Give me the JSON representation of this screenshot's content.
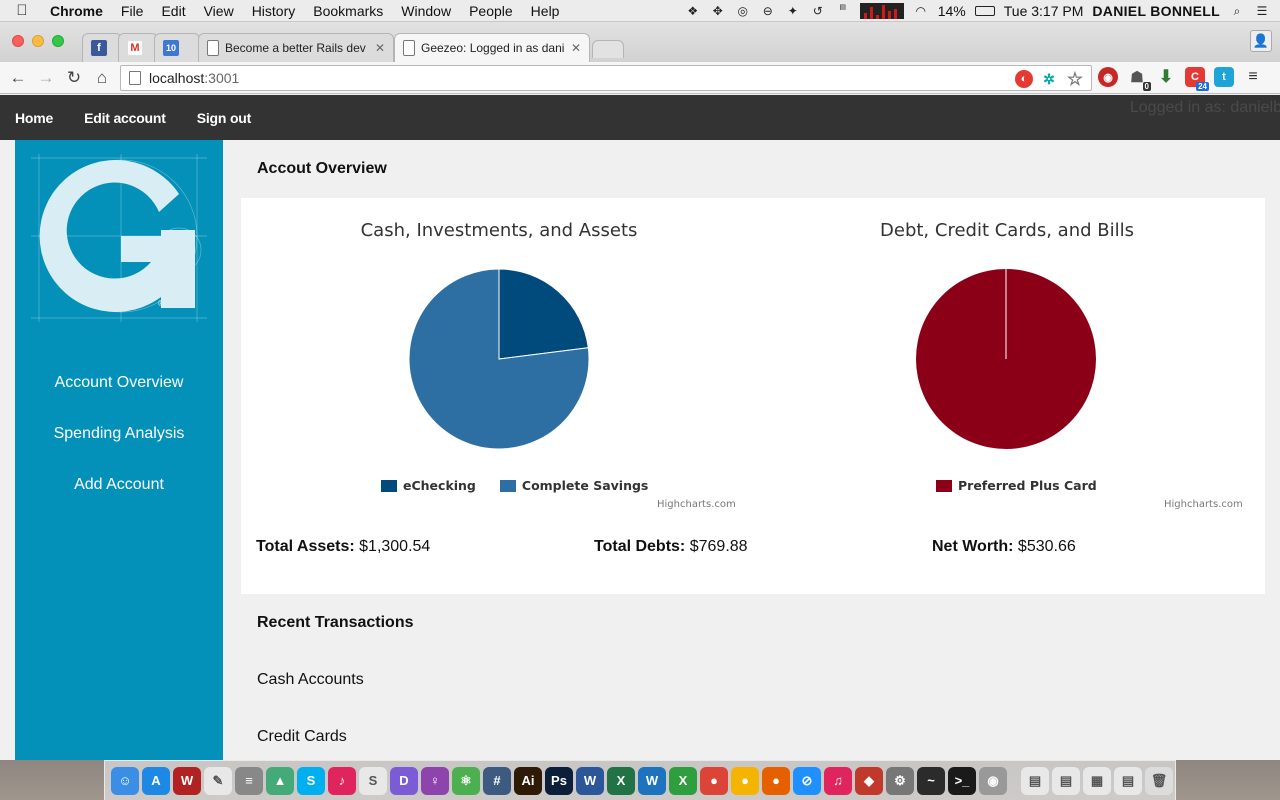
{
  "menubar": {
    "app": "Chrome",
    "items": [
      "File",
      "Edit",
      "View",
      "History",
      "Bookmarks",
      "Window",
      "People",
      "Help"
    ],
    "battery": "14%",
    "clock": "Tue 3:17 PM",
    "user": "DANIEL BONNELL"
  },
  "tabs": [
    {
      "title": "",
      "icon": "facebook-icon",
      "color": "#3b5998",
      "glyph": "f"
    },
    {
      "title": "",
      "icon": "gmail-icon",
      "color": "#ffffff",
      "glyph": "M"
    },
    {
      "title": "",
      "icon": "calendar-icon",
      "color": "#3f78d3",
      "glyph": "10"
    },
    {
      "title": "Become a better Rails dev",
      "icon": "page-icon"
    },
    {
      "title": "Geezeo: Logged in as dani",
      "icon": "page-icon",
      "active": true
    }
  ],
  "toolbar": {
    "url_host": "localhost",
    "url_port": ":3001",
    "calendar_badge": "10",
    "ext_badge_1": "0",
    "ext_badge_2": "24"
  },
  "sitenav": {
    "home": "Home",
    "edit_account": "Edit account",
    "sign_out": "Sign out",
    "logged_in": "Logged in as: danielb"
  },
  "sidebar": {
    "items": [
      "Account Overview",
      "Spending Analysis",
      "Add Account"
    ]
  },
  "main": {
    "overview_title": "Accout Overview",
    "recent_title": "Recent Transactions",
    "cash_accounts": "Cash Accounts",
    "credit_cards": "Credit Cards",
    "totals": {
      "assets_label": "Total Assets:",
      "assets_value": "$1,300.54",
      "debts_label": "Total Debts:",
      "debts_value": "$769.88",
      "net_label": "Net Worth:",
      "net_value": "$530.66"
    },
    "credits": "Highcharts.com"
  },
  "colors": {
    "nav_bg": "#333333",
    "sidebar_bg": "#0391ba",
    "echecking": "#004a7c",
    "savings": "#2e6fa3",
    "credit_card": "#8b0017"
  },
  "chart_data": [
    {
      "type": "pie",
      "title": "Cash, Investments, and Assets",
      "series": [
        {
          "name": "eChecking",
          "value": 23
        },
        {
          "name": "Complete Savings",
          "value": 77
        }
      ]
    },
    {
      "type": "pie",
      "title": "Debt, Credit Cards, and Bills",
      "series": [
        {
          "name": "Preferred Plus Card",
          "value": 100
        }
      ]
    }
  ],
  "dock": {
    "apps": [
      {
        "name": "finder-icon",
        "color": "#3a8ee6",
        "glyph": "☺"
      },
      {
        "name": "app-store-icon",
        "color": "#1e88e5",
        "glyph": "A"
      },
      {
        "name": "wineskin-icon",
        "color": "#b22222",
        "glyph": "W"
      },
      {
        "name": "textedit-icon",
        "color": "#e8e8e8",
        "glyph": "✎"
      },
      {
        "name": "notes-icon",
        "color": "#888888",
        "glyph": "≡"
      },
      {
        "name": "image-icon",
        "color": "#4a7",
        "glyph": "▲"
      },
      {
        "name": "skype-icon",
        "color": "#00aff0",
        "glyph": "S"
      },
      {
        "name": "music-app-icon",
        "color": "#e0245e",
        "glyph": "♪"
      },
      {
        "name": "slack-icon",
        "color": "#e8e8e8",
        "glyph": "S"
      },
      {
        "name": "dash-icon",
        "color": "#7b5bd6",
        "glyph": "D"
      },
      {
        "name": "tower-icon",
        "color": "#8e44ad",
        "glyph": "♀"
      },
      {
        "name": "atom-icon",
        "color": "#4caf50",
        "glyph": "⚛"
      },
      {
        "name": "calculator-icon",
        "color": "#3d5a80",
        "glyph": "#"
      },
      {
        "name": "illustrator-icon",
        "color": "#2f1a06",
        "glyph": "Ai"
      },
      {
        "name": "photoshop-icon",
        "color": "#0b1f3a",
        "glyph": "Ps"
      },
      {
        "name": "word-icon",
        "color": "#2b579a",
        "glyph": "W"
      },
      {
        "name": "excel-icon",
        "color": "#217346",
        "glyph": "X"
      },
      {
        "name": "word-alt-icon",
        "color": "#1e73be",
        "glyph": "W"
      },
      {
        "name": "crossover-icon",
        "color": "#2e9e3e",
        "glyph": "X"
      },
      {
        "name": "chrome-icon",
        "color": "#db4437",
        "glyph": "●"
      },
      {
        "name": "chrome-canary-icon",
        "color": "#f4b400",
        "glyph": "●"
      },
      {
        "name": "firefox-icon",
        "color": "#e66000",
        "glyph": "●"
      },
      {
        "name": "safari-icon",
        "color": "#1e90ff",
        "glyph": "⊘"
      },
      {
        "name": "itunes-icon",
        "color": "#e0245e",
        "glyph": "♫"
      },
      {
        "name": "codekit-icon",
        "color": "#c0392b",
        "glyph": "◆"
      },
      {
        "name": "system-preferences-icon",
        "color": "#777777",
        "glyph": "⚙"
      },
      {
        "name": "activity-monitor-icon",
        "color": "#2b2b2b",
        "glyph": "~"
      },
      {
        "name": "terminal-icon",
        "color": "#1a1a1a",
        "glyph": ">_"
      },
      {
        "name": "preview-icon",
        "color": "#999999",
        "glyph": "◉"
      }
    ],
    "docs": [
      {
        "name": "document-icon",
        "color": "#e8e8e8",
        "glyph": "▤"
      },
      {
        "name": "document-icon",
        "color": "#e8e8e8",
        "glyph": "▤"
      },
      {
        "name": "spreadsheet-doc-icon",
        "color": "#e8e8e8",
        "glyph": "▦"
      },
      {
        "name": "document-icon",
        "color": "#e8e8e8",
        "glyph": "▤"
      },
      {
        "name": "trash-icon",
        "color": "#dcdcdc",
        "glyph": "🗑"
      }
    ]
  }
}
